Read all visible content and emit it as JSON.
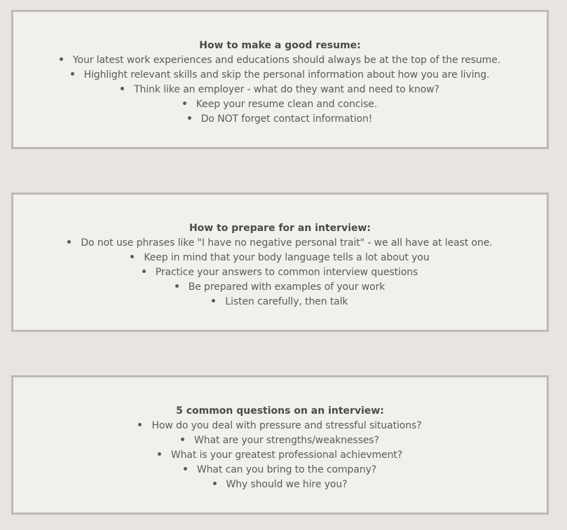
{
  "sections": [
    {
      "title": "How to make a good resume:",
      "items": [
        "Your latest work experiences and educations should always be at the top of the resume.",
        "Highlight relevant skills and skip the personal information about how you are living.",
        "Think like an employer - what do they want and need to know?",
        "Keep your resume clean and concise.",
        "Do NOT forget contact information!"
      ]
    },
    {
      "title": "How to prepare for an interview:",
      "items": [
        "Do not use phrases like \"I have no negative personal trait\" - we all have at least one.",
        "Keep in mind that your body language tells a lot about you",
        "Practice your answers to common interview questions",
        "Be prepared with examples of your work",
        "Listen carefully, then talk"
      ]
    },
    {
      "title": "5 common questions on an interview:",
      "items": [
        "How do you deal with pressure and stressful situations?",
        "What are your strengths/weaknesses?",
        "What is your greatest professional achievment?",
        "What can you bring to the company?",
        "Why should we hire you?"
      ]
    }
  ]
}
